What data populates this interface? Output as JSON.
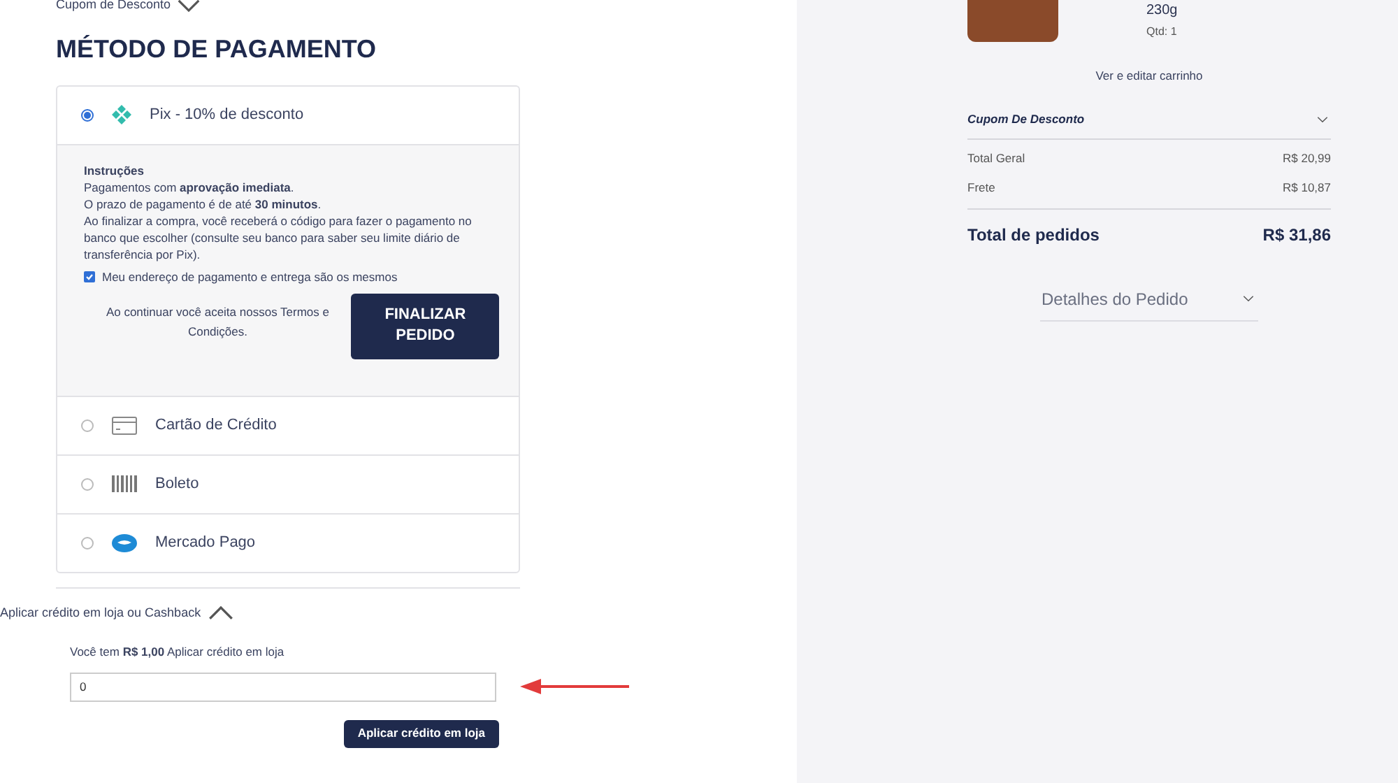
{
  "coupon_toggle": {
    "label": "Cupom de Desconto",
    "expanded": false
  },
  "heading": "MÉTODO DE PAGAMENTO",
  "payment_methods": [
    {
      "kind": "pix",
      "label": "Pix - 10% de desconto",
      "selected": true,
      "instructions": {
        "title": "Instruções",
        "lines": [
          "Pagamentos com **aprovação imediata**.",
          "O prazo de pagamento é de até **30 minutos**.",
          "Ao finalizar a compra, você receberá o código para fazer o pagamento no banco que escolher (consulte seu banco para saber seu limite diário de transferência por Pix)."
        ],
        "same_address": {
          "label": "Meu endereço de pagamento e entrega são os mesmos",
          "checked": true
        },
        "terms": "Ao continuar você aceita nossos Termos e Condições.",
        "button": "FINALIZAR PEDIDO"
      }
    },
    {
      "kind": "card",
      "label": "Cartão de Crédito",
      "selected": false
    },
    {
      "kind": "boleto",
      "label": "Boleto",
      "selected": false
    },
    {
      "kind": "mercadopago",
      "label": "Mercado Pago",
      "selected": false
    }
  ],
  "cashback": {
    "label": "Aplicar crédito em loja ou Cashback",
    "expanded": true,
    "balance_text": "Você tem **R$ 1,00** Aplicar crédito em loja",
    "value": "0",
    "button": "Aplicar crédito em loja"
  },
  "summary": {
    "product": {
      "weight": "230g",
      "quantity": "Qtd: 1"
    },
    "edit_cart": "Ver e editar carrinho",
    "coupon": "Cupom De Desconto",
    "rows": [
      {
        "label": "Total Geral",
        "value": "R$ 20,99"
      },
      {
        "label": "Frete",
        "value": "R$ 10,87"
      }
    ],
    "total": {
      "label": "Total de pedidos",
      "value": "R$ 31,86"
    },
    "details": "Detalhes do Pedido"
  }
}
